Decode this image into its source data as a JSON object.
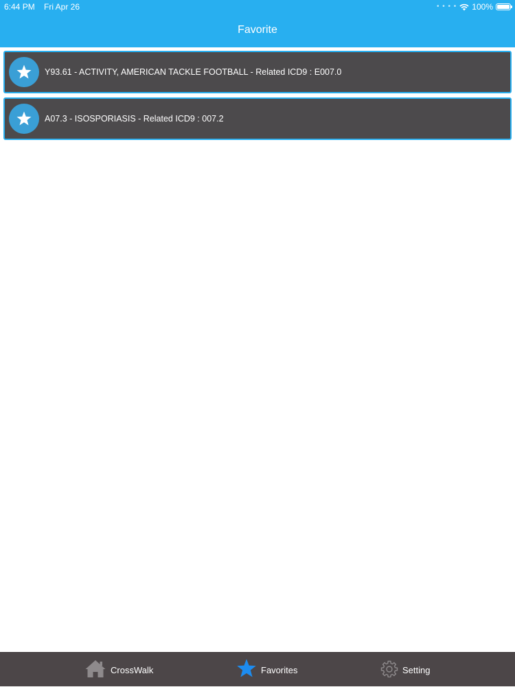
{
  "status_bar": {
    "time": "6:44 PM",
    "date": "Fri Apr 26",
    "battery": "100%",
    "icons": [
      "signal-dots",
      "wifi-icon",
      "battery-icon"
    ]
  },
  "nav": {
    "title": "Favorite"
  },
  "favorites": [
    {
      "icon": "star-icon",
      "text": "Y93.61 - ACTIVITY, AMERICAN TACKLE FOOTBALL - Related ICD9 : E007.0"
    },
    {
      "icon": "star-icon",
      "text": "A07.3 - ISOSPORIASIS - Related ICD9 : 007.2"
    }
  ],
  "tabs": [
    {
      "label": "CrossWalk",
      "icon": "home-icon",
      "selected": false
    },
    {
      "label": "Favorites",
      "icon": "star-icon",
      "selected": true
    },
    {
      "label": "Setting",
      "icon": "gear-icon",
      "selected": false
    }
  ],
  "colors": {
    "header_blue": "#28aff0",
    "row_background": "#4c4a4c",
    "star_badge": "#3a9fd6",
    "tab_bar": "#4c4648",
    "tab_selected_icon": "#1d8cf0",
    "tab_icon_gray": "#8e8a8c"
  }
}
